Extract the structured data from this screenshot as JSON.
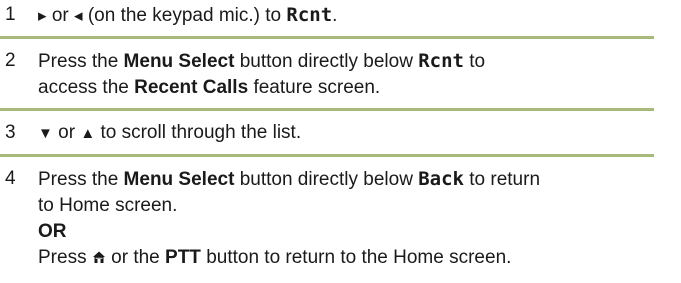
{
  "steps": [
    {
      "number": "1",
      "right_arrow": "▸",
      "or_1": "or",
      "left_arrow": "◂",
      "text_a": "(on the keypad mic.) to",
      "key": "Rcnt",
      "text_b": "."
    },
    {
      "number": "2",
      "text_a": "Press the",
      "button_label": "Menu Select",
      "text_b": "button directly below",
      "key": "Rcnt",
      "text_c": "to",
      "line2_a": "access the",
      "feature_label": "Recent Calls",
      "line2_b": "feature screen."
    },
    {
      "number": "3",
      "down_arrow": "▼",
      "or_1": "or",
      "up_arrow": "▲",
      "text_a": "to scroll through the list."
    },
    {
      "number": "4",
      "text_a": "Press the",
      "button_label": "Menu Select",
      "text_b": "button directly below",
      "key": "Back",
      "text_c": "to return",
      "line2": "to Home screen.",
      "or_label": "OR",
      "line4_a": "Press",
      "home_icon": "home-icon",
      "line4_b": "or the",
      "ptt_label": "PTT",
      "line4_c": "button to return to the Home screen."
    }
  ]
}
